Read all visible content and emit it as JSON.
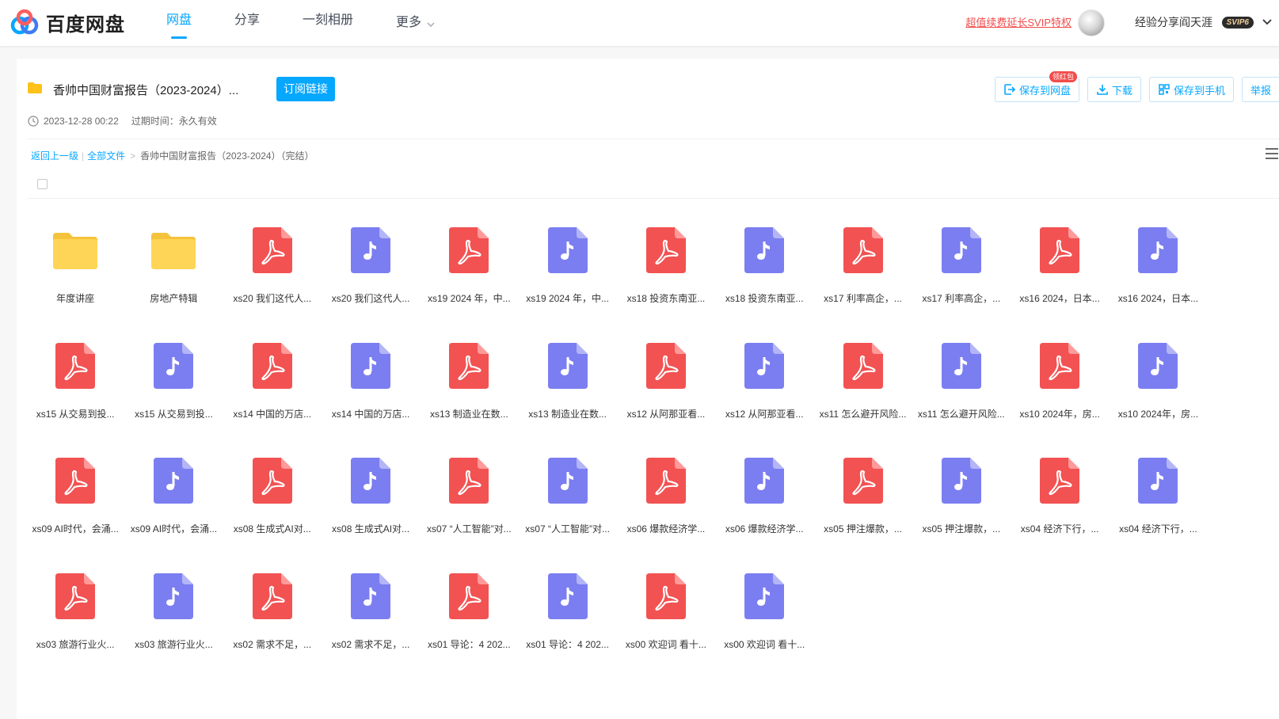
{
  "colors": {
    "accent": "#06a7ff",
    "pdf": "#f25252",
    "audio": "#7b7ef0",
    "folder": "#ffd557",
    "svip": "#f24c4c"
  },
  "topbar": {
    "logo_text": "百度网盘",
    "nav": [
      {
        "label": "网盘",
        "active": true
      },
      {
        "label": "分享",
        "active": false
      },
      {
        "label": "一刻相册",
        "active": false
      },
      {
        "label": "更多",
        "active": false
      }
    ],
    "svip_link": "超值续费延长SVIP特权",
    "user_name": "经验分享阎天涯",
    "vip_badge": "SVIP6"
  },
  "share": {
    "title": "香帅中国财富报告（2023-2024）...",
    "subscribe_label": "订阅链接",
    "created": "2023-12-28 00:22",
    "expire": "过期时间：永久有效"
  },
  "actions": {
    "save_label": "保存到网盘",
    "save_badge": "领红包",
    "download_label": "下载",
    "save_phone_label": "保存到手机",
    "report_label": "举报"
  },
  "breadcrumb": {
    "back": "返回上一级",
    "all": "全部文件",
    "sep": ">",
    "bar": "|",
    "current": "香帅中国财富报告（2023-2024）（完结）"
  },
  "files": [
    {
      "name": "年度讲座",
      "type": "folder"
    },
    {
      "name": "房地产特辑",
      "type": "folder"
    },
    {
      "name": "xs20 我们这代人...",
      "type": "pdf"
    },
    {
      "name": "xs20 我们这代人...",
      "type": "audio"
    },
    {
      "name": "xs19 2024 年，中...",
      "type": "pdf"
    },
    {
      "name": "xs19 2024 年，中...",
      "type": "audio"
    },
    {
      "name": "xs18 投资东南亚...",
      "type": "pdf"
    },
    {
      "name": "xs18 投资东南亚...",
      "type": "audio"
    },
    {
      "name": "xs17 利率高企，...",
      "type": "pdf"
    },
    {
      "name": "xs17 利率高企，...",
      "type": "audio"
    },
    {
      "name": "xs16 2024，日本...",
      "type": "pdf"
    },
    {
      "name": "xs16 2024，日本...",
      "type": "audio"
    },
    {
      "name": "xs15 从交易到投...",
      "type": "pdf"
    },
    {
      "name": "xs15 从交易到投...",
      "type": "audio"
    },
    {
      "name": "xs14 中国的万店...",
      "type": "pdf"
    },
    {
      "name": "xs14 中国的万店...",
      "type": "audio"
    },
    {
      "name": "xs13 制造业在数...",
      "type": "pdf"
    },
    {
      "name": "xs13 制造业在数...",
      "type": "audio"
    },
    {
      "name": "xs12 从阿那亚看...",
      "type": "pdf"
    },
    {
      "name": "xs12 从阿那亚看...",
      "type": "audio"
    },
    {
      "name": "xs11 怎么避开风险...",
      "type": "pdf"
    },
    {
      "name": "xs11 怎么避开风险...",
      "type": "audio"
    },
    {
      "name": "xs10 2024年，房...",
      "type": "pdf"
    },
    {
      "name": "xs10 2024年，房...",
      "type": "audio"
    },
    {
      "name": "xs09 AI时代，会涌...",
      "type": "pdf"
    },
    {
      "name": "xs09 AI时代，会涌...",
      "type": "audio"
    },
    {
      "name": "xs08 生成式AI对...",
      "type": "pdf"
    },
    {
      "name": "xs08 生成式AI对...",
      "type": "audio"
    },
    {
      "name": "xs07 “人工智能”对...",
      "type": "pdf"
    },
    {
      "name": "xs07 “人工智能”对...",
      "type": "audio"
    },
    {
      "name": "xs06 爆款经济学...",
      "type": "pdf"
    },
    {
      "name": "xs06 爆款经济学...",
      "type": "audio"
    },
    {
      "name": "xs05 押注爆款，...",
      "type": "pdf"
    },
    {
      "name": "xs05 押注爆款，...",
      "type": "audio"
    },
    {
      "name": "xs04 经济下行，...",
      "type": "pdf"
    },
    {
      "name": "xs04 经济下行，...",
      "type": "audio"
    },
    {
      "name": "xs03 旅游行业火...",
      "type": "pdf"
    },
    {
      "name": "xs03 旅游行业火...",
      "type": "audio"
    },
    {
      "name": "xs02 需求不足，...",
      "type": "pdf"
    },
    {
      "name": "xs02 需求不足，...",
      "type": "audio"
    },
    {
      "name": "xs01 导论：4 202...",
      "type": "pdf"
    },
    {
      "name": "xs01 导论：4 202...",
      "type": "audio"
    },
    {
      "name": "xs00 欢迎词 看十...",
      "type": "pdf"
    },
    {
      "name": "xs00 欢迎词 看十...",
      "type": "audio"
    }
  ]
}
